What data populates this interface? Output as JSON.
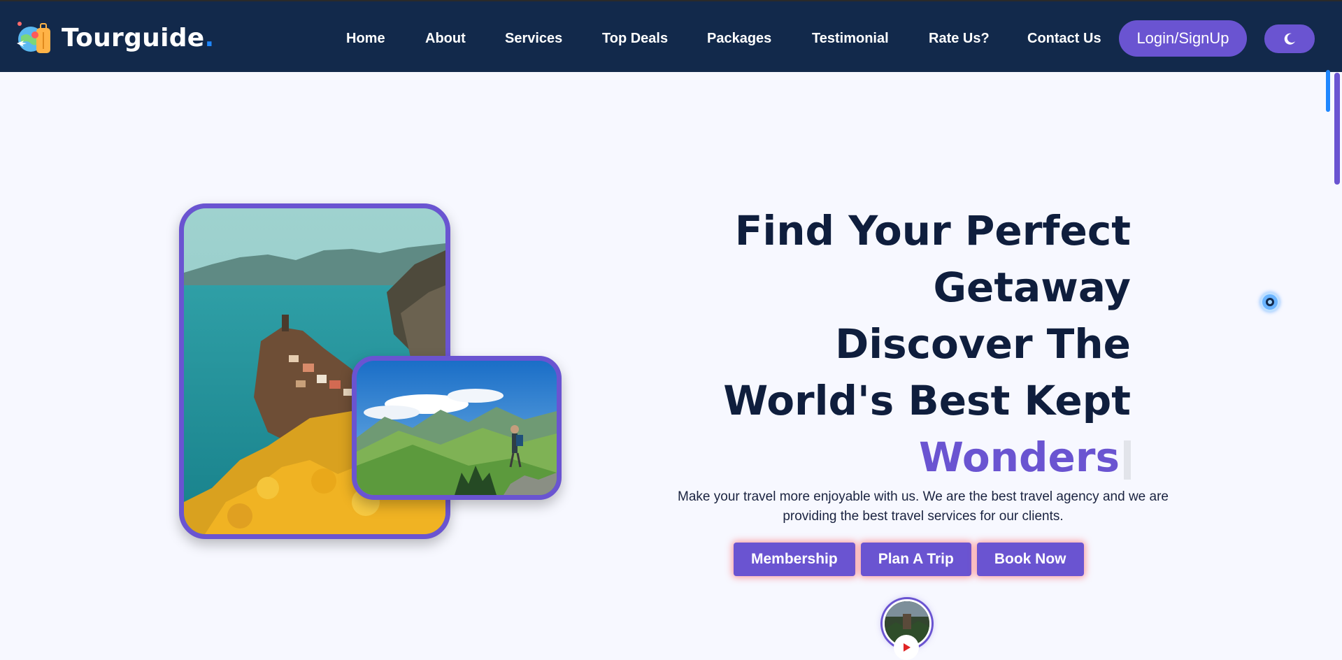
{
  "brand": {
    "name": "Tourguide",
    "dot": ".",
    "logo_icon": "globe-luggage-icon"
  },
  "nav": {
    "items": [
      {
        "label": "Home"
      },
      {
        "label": "About"
      },
      {
        "label": "Services"
      },
      {
        "label": "Top Deals"
      },
      {
        "label": "Packages"
      },
      {
        "label": "Testimonial"
      },
      {
        "label": "Rate Us?"
      },
      {
        "label": "Contact Us"
      }
    ],
    "login_label": "Login/SignUp",
    "theme_icon": "moon-icon"
  },
  "hero": {
    "headline_lines": [
      "Find Your Perfect",
      "Getaway",
      "Discover The",
      "World's Best Kept"
    ],
    "accent_word": "Wonders",
    "subtitle": "Make your travel more enjoyable with us. We are the best travel agency and we are providing the best travel services for our clients.",
    "buttons": [
      {
        "label": "Membership"
      },
      {
        "label": "Plan A Trip"
      },
      {
        "label": "Book Now"
      }
    ],
    "large_image": "coastal-village-cliff-image",
    "small_image": "mountain-hiker-image",
    "video_icon": "play-icon"
  },
  "colors": {
    "navbar_bg": "#12294b",
    "accent": "#6a54d1",
    "page_bg": "#f7f8ff",
    "headline": "#0f1e3d",
    "brand_dot": "#1f87ff"
  }
}
